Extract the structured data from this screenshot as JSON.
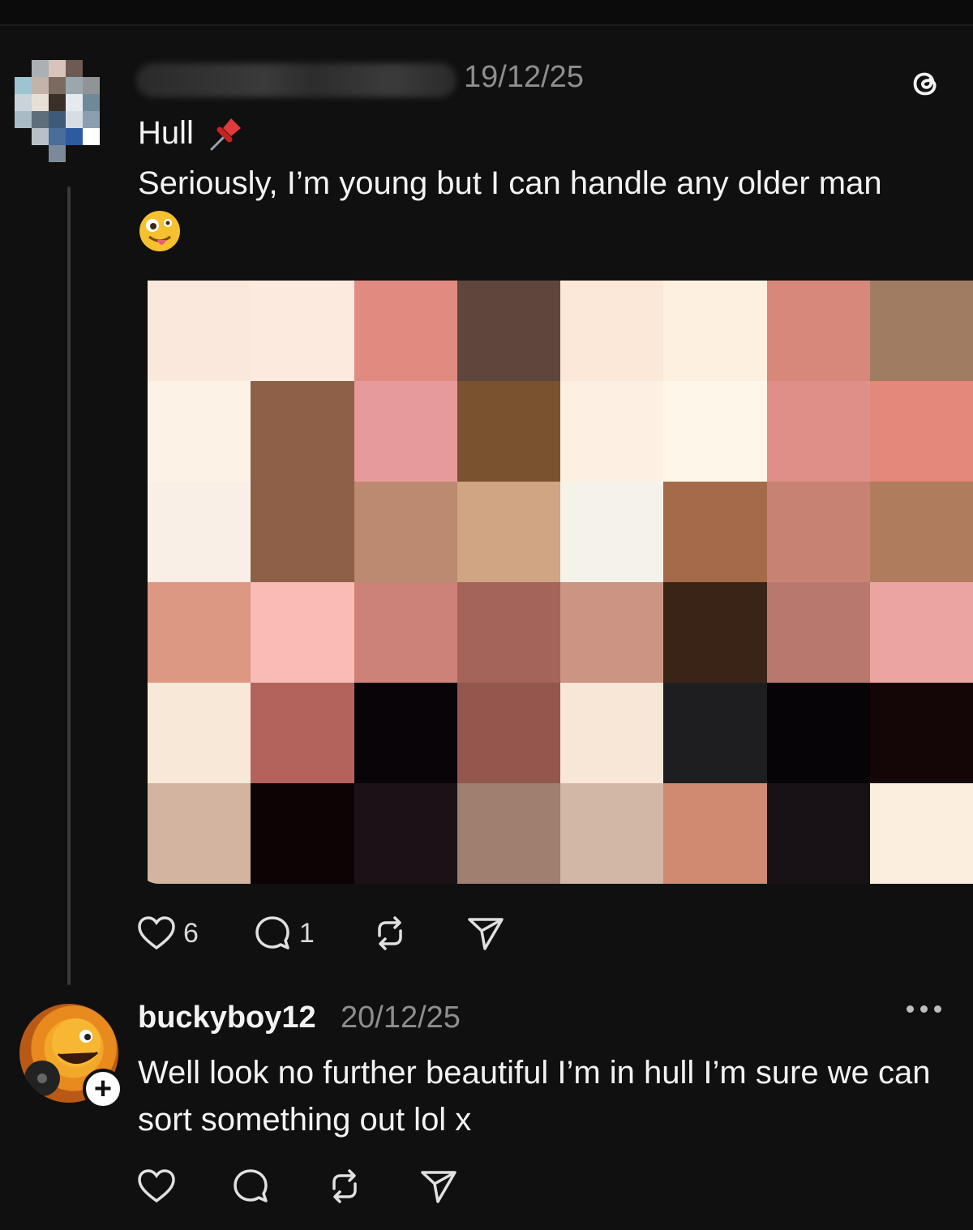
{
  "post": {
    "date": "19/12/25",
    "title": "Hull",
    "title_icon": "pushpin-icon",
    "body": "Seriously, I’m young but I can handle any older man",
    "body_emoji": "zany-face-emoji",
    "likes": "6",
    "comments": "1"
  },
  "reply": {
    "username": "buckyboy12",
    "date": "20/12/25",
    "body": "Well look no further beautiful I’m in hull I’m sure we can sort something out lol x"
  },
  "colors": {
    "background": "#101010",
    "text": "#f3f3f3",
    "muted": "#8e8e8e"
  }
}
